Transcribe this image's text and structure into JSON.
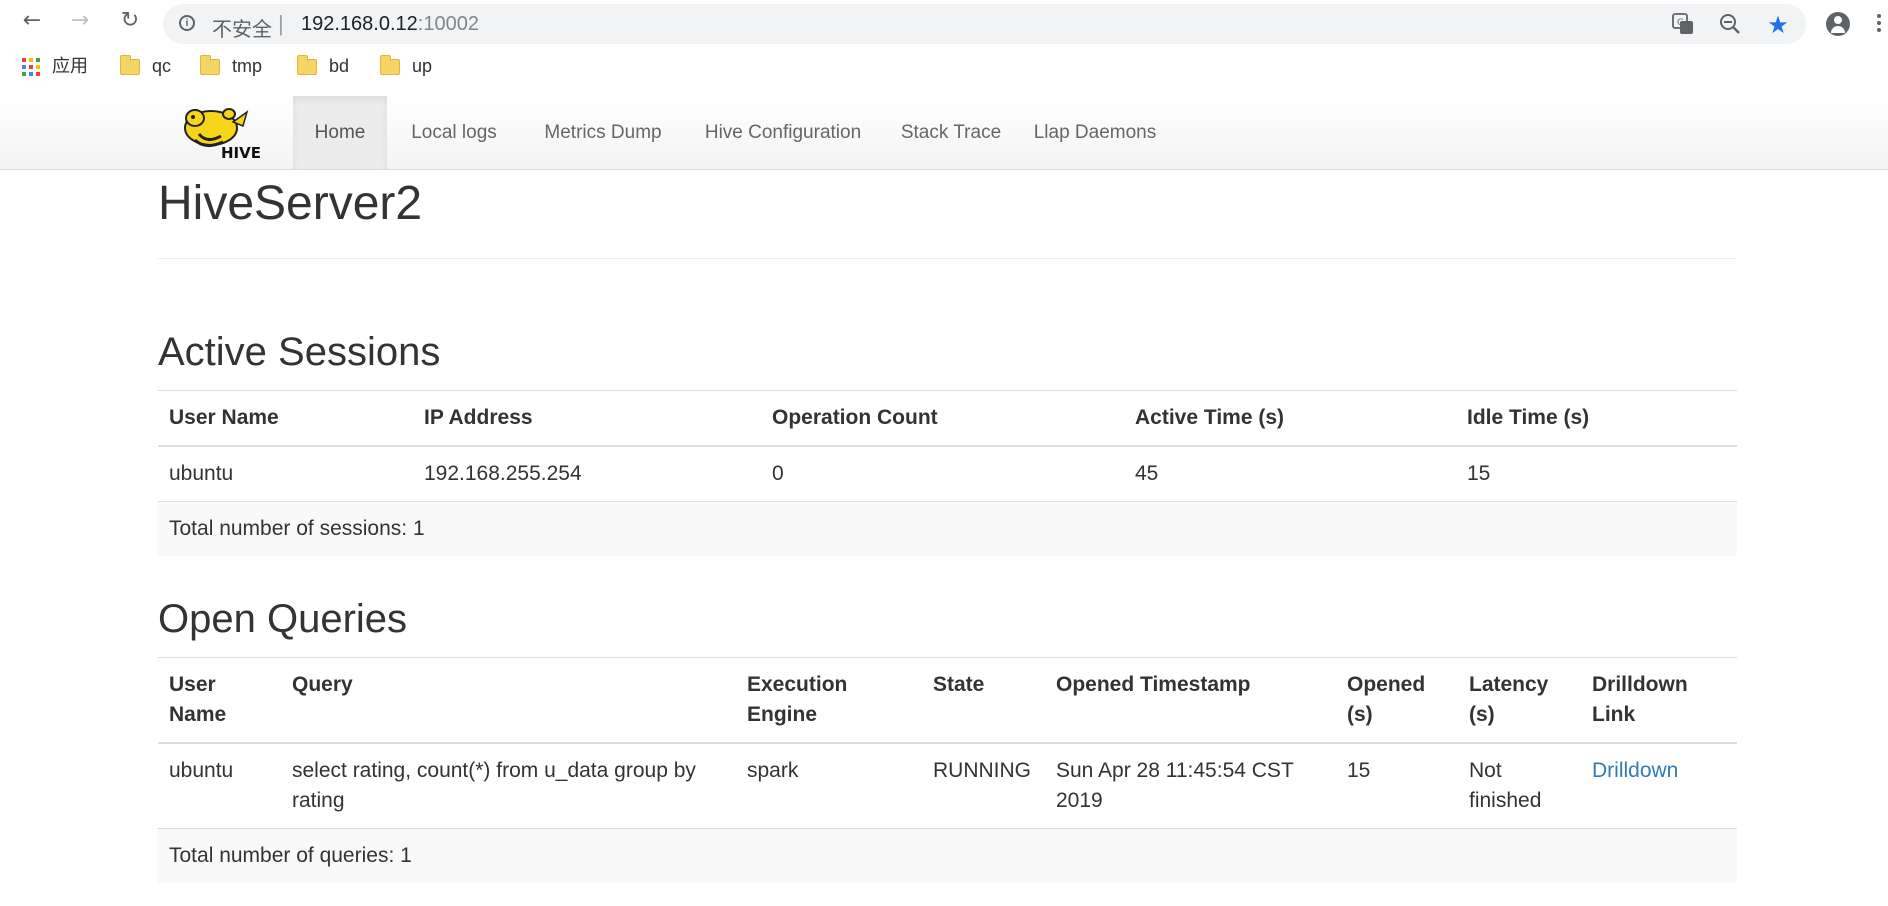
{
  "browser": {
    "security_label": "不安全",
    "url_host": "192.168.0.12",
    "url_port": ":10002"
  },
  "bookmarks": {
    "apps_label": "应用",
    "items": [
      {
        "label": "qc"
      },
      {
        "label": "tmp"
      },
      {
        "label": "bd"
      },
      {
        "label": "up"
      }
    ]
  },
  "navbar": {
    "logo_text": "HIVE",
    "items": [
      {
        "label": "Home",
        "active": true
      },
      {
        "label": "Local logs"
      },
      {
        "label": "Metrics Dump"
      },
      {
        "label": "Hive Configuration"
      },
      {
        "label": "Stack Trace"
      },
      {
        "label": "Llap Daemons"
      }
    ]
  },
  "page": {
    "title": "HiveServer2"
  },
  "active_sessions": {
    "title": "Active Sessions",
    "columns": [
      "User Name",
      "IP Address",
      "Operation Count",
      "Active Time (s)",
      "Idle Time (s)"
    ],
    "rows": [
      [
        "ubuntu",
        "192.168.255.254",
        "0",
        "45",
        "15"
      ]
    ],
    "total": "Total number of sessions: 1"
  },
  "open_queries": {
    "title": "Open Queries",
    "columns": [
      "User Name",
      "Query",
      "Execution Engine",
      "State",
      "Opened Timestamp",
      "Opened (s)",
      "Latency (s)",
      "Drilldown Link"
    ],
    "rows": [
      [
        "ubuntu",
        "select rating, count(*) from u_data group by rating",
        "spark",
        "RUNNING",
        "Sun Apr 28 11:45:54 CST 2019",
        "15",
        "Not finished",
        "Drilldown"
      ]
    ],
    "total": "Total number of queries: 1"
  },
  "colors": {
    "link": "#337ab7",
    "star": "#1a73e8",
    "logo_yellow": "#f5d51a"
  }
}
